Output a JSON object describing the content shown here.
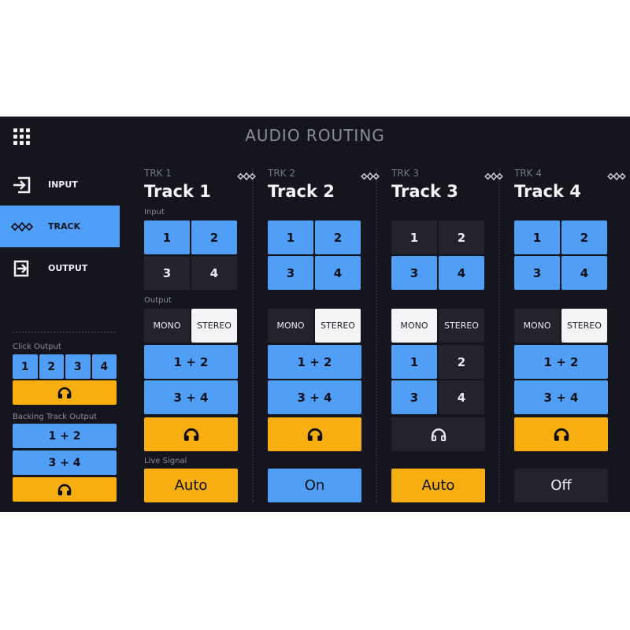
{
  "app": {
    "title": "AUDIO ROUTING",
    "menu_icon": "grid-menu-icon"
  },
  "colors": {
    "background": "#15151d",
    "accent_blue": "#519ef7",
    "accent_yellow": "#f7ae10",
    "inactive": "#23242b",
    "selected_white": "#f3f4f6"
  },
  "sidebar": {
    "items": [
      {
        "label": "INPUT",
        "icon": "input-arrow-icon",
        "active": false
      },
      {
        "label": "TRACK",
        "icon": "track-wave-icon",
        "active": true
      },
      {
        "label": "OUTPUT",
        "icon": "output-arrow-icon",
        "active": false
      }
    ],
    "click_output": {
      "label": "Click Output",
      "channels": [
        "1",
        "2",
        "3",
        "4"
      ],
      "headphones_icon": "headphones-icon"
    },
    "backing_track_output": {
      "label": "Backing Track Output",
      "pairs": [
        "1 + 2",
        "3 + 4"
      ],
      "headphones_icon": "headphones-icon"
    }
  },
  "labels": {
    "input": "Input",
    "output": "Output",
    "live_signal": "Live Signal",
    "mono": "MONO",
    "stereo": "STEREO"
  },
  "tracks": [
    {
      "trk": "TRK 1",
      "name": "Track 1",
      "inputs": [
        {
          "label": "1",
          "on": true
        },
        {
          "label": "2",
          "on": true
        },
        {
          "label": "3",
          "on": false
        },
        {
          "label": "4",
          "on": false
        }
      ],
      "mode": "STEREO",
      "outputs": [
        "1 + 2",
        "3 + 4"
      ],
      "headphones": true,
      "live_signal": "Auto"
    },
    {
      "trk": "TRK 2",
      "name": "Track 2",
      "inputs": [
        {
          "label": "1",
          "on": true
        },
        {
          "label": "2",
          "on": true
        },
        {
          "label": "3",
          "on": true
        },
        {
          "label": "4",
          "on": true
        }
      ],
      "mode": "STEREO",
      "outputs": [
        "1 + 2",
        "3 + 4"
      ],
      "headphones": true,
      "live_signal": "On"
    },
    {
      "trk": "TRK 3",
      "name": "Track 3",
      "inputs": [
        {
          "label": "1",
          "on": false
        },
        {
          "label": "2",
          "on": false
        },
        {
          "label": "3",
          "on": true
        },
        {
          "label": "4",
          "on": true
        }
      ],
      "mode": "MONO",
      "outputs_mono": [
        {
          "label": "1",
          "on": true
        },
        {
          "label": "2",
          "on": false
        },
        {
          "label": "3",
          "on": true
        },
        {
          "label": "4",
          "on": false
        }
      ],
      "headphones": false,
      "live_signal": "Auto"
    },
    {
      "trk": "TRK 4",
      "name": "Track 4",
      "inputs": [
        {
          "label": "1",
          "on": true
        },
        {
          "label": "2",
          "on": true
        },
        {
          "label": "3",
          "on": true
        },
        {
          "label": "4",
          "on": true
        }
      ],
      "mode": "STEREO",
      "outputs": [
        "1 + 2",
        "3 + 4"
      ],
      "headphones": true,
      "live_signal": "Off"
    }
  ]
}
